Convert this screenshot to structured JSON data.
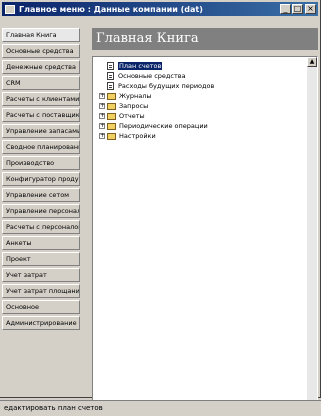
{
  "window": {
    "title": "Главное меню : Данные компании (dat)",
    "buttons": {
      "minimize": "_",
      "maximize": "□",
      "close": "×"
    }
  },
  "sidebar": {
    "items": [
      {
        "label": "Главная Книга"
      },
      {
        "label": "Основные средства"
      },
      {
        "label": "Денежные средства"
      },
      {
        "label": "СRМ"
      },
      {
        "label": "Расчеты с клиентами"
      },
      {
        "label": "Расчеты с поставщиками"
      },
      {
        "label": "Управление запасами"
      },
      {
        "label": "Сводное планирование"
      },
      {
        "label": "Производство"
      },
      {
        "label": "Конфигуратор продукции"
      },
      {
        "label": "Управление сетом"
      },
      {
        "label": "Управление персоналом"
      },
      {
        "label": "Расчеты с персоналом"
      },
      {
        "label": "Анкеты"
      },
      {
        "label": "Проект"
      },
      {
        "label": "Учет затрат"
      },
      {
        "label": "Учет затрат площания"
      },
      {
        "label": "Основное"
      },
      {
        "label": "Администрирование"
      }
    ]
  },
  "main": {
    "header": "Главная Книга",
    "tree": [
      {
        "label": "План счетов",
        "type": "doc",
        "selected": true
      },
      {
        "label": "Основные средства",
        "type": "doc"
      },
      {
        "label": "Расходы будущих периодов",
        "type": "doc"
      },
      {
        "label": "Журналы",
        "type": "folder"
      },
      {
        "label": "Запросы",
        "type": "folder"
      },
      {
        "label": "Отчеты",
        "type": "folder"
      },
      {
        "label": "Периодические операции",
        "type": "folder"
      },
      {
        "label": "Настройки",
        "type": "folder"
      }
    ]
  },
  "statusbar": {
    "text": "едактировать план счетов"
  },
  "colors": {
    "titlebar": "#0a246a",
    "header": "#808080",
    "selection": "#0a246a"
  }
}
